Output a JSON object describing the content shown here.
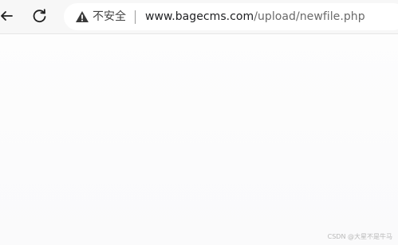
{
  "toolbar": {
    "back_icon": "arrow-left-icon",
    "reload_icon": "reload-icon",
    "security_icon": "warning-triangle-icon",
    "security_text": "不安全",
    "url_host": "www.bagecms.com",
    "url_path": "/upload/newfile.php"
  },
  "watermark": {
    "text": "CSDN @大星不是牛马"
  }
}
